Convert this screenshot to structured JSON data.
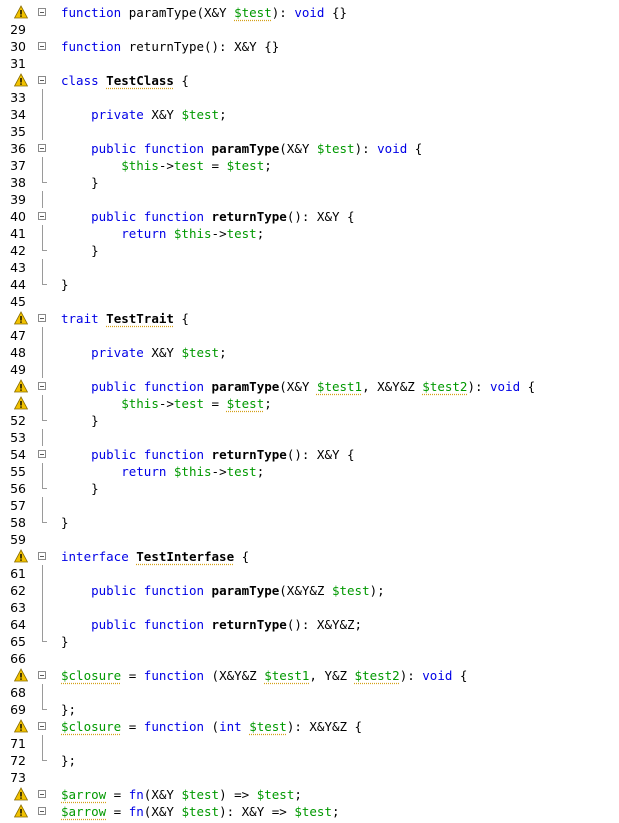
{
  "colors": {
    "keyword": "#0000e6",
    "variable": "#009900",
    "warning": "#e6b800",
    "text": "#000000"
  },
  "lines": [
    {
      "no": "",
      "warn": true,
      "fold": "start",
      "tokens": [
        {
          "t": "function",
          "c": "k"
        },
        {
          "t": " paramType(X&Y "
        },
        {
          "t": "$test",
          "c": "v wv"
        },
        {
          "t": "): "
        },
        {
          "t": "void",
          "c": "k"
        },
        {
          "t": " {}"
        }
      ]
    },
    {
      "no": "29",
      "tokens": []
    },
    {
      "no": "30",
      "fold": "start",
      "tokens": [
        {
          "t": "function",
          "c": "k"
        },
        {
          "t": " returnType(): X&Y {}"
        }
      ]
    },
    {
      "no": "31",
      "tokens": []
    },
    {
      "no": "",
      "warn": true,
      "fold": "start",
      "tokens": [
        {
          "t": "class",
          "c": "k"
        },
        {
          "t": " "
        },
        {
          "t": "TestClass",
          "c": "b wv"
        },
        {
          "t": " {"
        }
      ]
    },
    {
      "no": "33",
      "fold": "line",
      "tokens": []
    },
    {
      "no": "34",
      "fold": "line",
      "tokens": [
        {
          "t": "    "
        },
        {
          "t": "private",
          "c": "k"
        },
        {
          "t": " X&Y "
        },
        {
          "t": "$test",
          "c": "v"
        },
        {
          "t": ";"
        }
      ]
    },
    {
      "no": "35",
      "fold": "line",
      "tokens": []
    },
    {
      "no": "36",
      "fold": "start",
      "tokens": [
        {
          "t": "    "
        },
        {
          "t": "public",
          "c": "k"
        },
        {
          "t": " "
        },
        {
          "t": "function",
          "c": "k"
        },
        {
          "t": " "
        },
        {
          "t": "paramType",
          "c": "b"
        },
        {
          "t": "(X&Y "
        },
        {
          "t": "$test",
          "c": "v"
        },
        {
          "t": "): "
        },
        {
          "t": "void",
          "c": "k"
        },
        {
          "t": " {"
        }
      ]
    },
    {
      "no": "37",
      "fold": "line",
      "tokens": [
        {
          "t": "        "
        },
        {
          "t": "$this",
          "c": "v"
        },
        {
          "t": "->"
        },
        {
          "t": "test",
          "c": "v"
        },
        {
          "t": " = "
        },
        {
          "t": "$test",
          "c": "v"
        },
        {
          "t": ";"
        }
      ]
    },
    {
      "no": "38",
      "fold": "end",
      "tokens": [
        {
          "t": "    }"
        }
      ]
    },
    {
      "no": "39",
      "fold": "line",
      "tokens": []
    },
    {
      "no": "40",
      "fold": "start",
      "tokens": [
        {
          "t": "    "
        },
        {
          "t": "public",
          "c": "k"
        },
        {
          "t": " "
        },
        {
          "t": "function",
          "c": "k"
        },
        {
          "t": " "
        },
        {
          "t": "returnType",
          "c": "b"
        },
        {
          "t": "(): X&Y {"
        }
      ]
    },
    {
      "no": "41",
      "fold": "line",
      "tokens": [
        {
          "t": "        "
        },
        {
          "t": "return",
          "c": "k"
        },
        {
          "t": " "
        },
        {
          "t": "$this",
          "c": "v"
        },
        {
          "t": "->"
        },
        {
          "t": "test",
          "c": "v"
        },
        {
          "t": ";"
        }
      ]
    },
    {
      "no": "42",
      "fold": "end",
      "tokens": [
        {
          "t": "    }"
        }
      ]
    },
    {
      "no": "43",
      "fold": "line",
      "tokens": []
    },
    {
      "no": "44",
      "fold": "end",
      "tokens": [
        {
          "t": "}"
        }
      ]
    },
    {
      "no": "45",
      "tokens": []
    },
    {
      "no": "",
      "warn": true,
      "fold": "start",
      "tokens": [
        {
          "t": "trait",
          "c": "k"
        },
        {
          "t": " "
        },
        {
          "t": "TestTrait",
          "c": "b wv"
        },
        {
          "t": " {"
        }
      ]
    },
    {
      "no": "47",
      "fold": "line",
      "tokens": []
    },
    {
      "no": "48",
      "fold": "line",
      "tokens": [
        {
          "t": "    "
        },
        {
          "t": "private",
          "c": "k"
        },
        {
          "t": " X&Y "
        },
        {
          "t": "$test",
          "c": "v"
        },
        {
          "t": ";"
        }
      ]
    },
    {
      "no": "49",
      "fold": "line",
      "tokens": []
    },
    {
      "no": "",
      "warn": true,
      "fold": "start",
      "tokens": [
        {
          "t": "    "
        },
        {
          "t": "public",
          "c": "k"
        },
        {
          "t": " "
        },
        {
          "t": "function",
          "c": "k"
        },
        {
          "t": " "
        },
        {
          "t": "paramType",
          "c": "b"
        },
        {
          "t": "(X&Y "
        },
        {
          "t": "$test1",
          "c": "v wv"
        },
        {
          "t": ", X&Y&Z "
        },
        {
          "t": "$test2",
          "c": "v wv"
        },
        {
          "t": "): "
        },
        {
          "t": "void",
          "c": "k"
        },
        {
          "t": " {"
        }
      ]
    },
    {
      "no": "",
      "warn": true,
      "fold": "line",
      "tokens": [
        {
          "t": "        "
        },
        {
          "t": "$this",
          "c": "v"
        },
        {
          "t": "->"
        },
        {
          "t": "test",
          "c": "v"
        },
        {
          "t": " = "
        },
        {
          "t": "$test",
          "c": "v wv"
        },
        {
          "t": ";"
        }
      ]
    },
    {
      "no": "52",
      "fold": "end",
      "tokens": [
        {
          "t": "    }"
        }
      ]
    },
    {
      "no": "53",
      "fold": "line",
      "tokens": []
    },
    {
      "no": "54",
      "fold": "start",
      "tokens": [
        {
          "t": "    "
        },
        {
          "t": "public",
          "c": "k"
        },
        {
          "t": " "
        },
        {
          "t": "function",
          "c": "k"
        },
        {
          "t": " "
        },
        {
          "t": "returnType",
          "c": "b"
        },
        {
          "t": "(): X&Y {"
        }
      ]
    },
    {
      "no": "55",
      "fold": "line",
      "tokens": [
        {
          "t": "        "
        },
        {
          "t": "return",
          "c": "k"
        },
        {
          "t": " "
        },
        {
          "t": "$this",
          "c": "v"
        },
        {
          "t": "->"
        },
        {
          "t": "test",
          "c": "v"
        },
        {
          "t": ";"
        }
      ]
    },
    {
      "no": "56",
      "fold": "end",
      "tokens": [
        {
          "t": "    }"
        }
      ]
    },
    {
      "no": "57",
      "fold": "line",
      "tokens": []
    },
    {
      "no": "58",
      "fold": "end",
      "tokens": [
        {
          "t": "}"
        }
      ]
    },
    {
      "no": "59",
      "tokens": []
    },
    {
      "no": "",
      "warn": true,
      "fold": "start",
      "tokens": [
        {
          "t": "interface",
          "c": "k"
        },
        {
          "t": " "
        },
        {
          "t": "TestInterfase",
          "c": "b wv"
        },
        {
          "t": " {"
        }
      ]
    },
    {
      "no": "61",
      "fold": "line",
      "tokens": []
    },
    {
      "no": "62",
      "fold": "line",
      "tokens": [
        {
          "t": "    "
        },
        {
          "t": "public",
          "c": "k"
        },
        {
          "t": " "
        },
        {
          "t": "function",
          "c": "k"
        },
        {
          "t": " "
        },
        {
          "t": "paramType",
          "c": "b"
        },
        {
          "t": "(X&Y&Z "
        },
        {
          "t": "$test",
          "c": "v"
        },
        {
          "t": ");"
        }
      ]
    },
    {
      "no": "63",
      "fold": "line",
      "tokens": []
    },
    {
      "no": "64",
      "fold": "line",
      "tokens": [
        {
          "t": "    "
        },
        {
          "t": "public",
          "c": "k"
        },
        {
          "t": " "
        },
        {
          "t": "function",
          "c": "k"
        },
        {
          "t": " "
        },
        {
          "t": "returnType",
          "c": "b"
        },
        {
          "t": "(): X&Y&Z;"
        }
      ]
    },
    {
      "no": "65",
      "fold": "end",
      "tokens": [
        {
          "t": "}"
        }
      ]
    },
    {
      "no": "66",
      "tokens": []
    },
    {
      "no": "",
      "warn": true,
      "fold": "start",
      "tokens": [
        {
          "t": "$closure",
          "c": "v wv"
        },
        {
          "t": " = "
        },
        {
          "t": "function",
          "c": "k"
        },
        {
          "t": " (X&Y&Z "
        },
        {
          "t": "$test1",
          "c": "v wv"
        },
        {
          "t": ", Y&Z "
        },
        {
          "t": "$test2",
          "c": "v wv"
        },
        {
          "t": "): "
        },
        {
          "t": "void",
          "c": "k"
        },
        {
          "t": " {"
        }
      ]
    },
    {
      "no": "68",
      "fold": "line",
      "tokens": []
    },
    {
      "no": "69",
      "fold": "end",
      "tokens": [
        {
          "t": "};"
        }
      ]
    },
    {
      "no": "",
      "warn": true,
      "fold": "start",
      "tokens": [
        {
          "t": "$closure",
          "c": "v wv"
        },
        {
          "t": " = "
        },
        {
          "t": "function",
          "c": "k"
        },
        {
          "t": " ("
        },
        {
          "t": "int",
          "c": "k"
        },
        {
          "t": " "
        },
        {
          "t": "$test",
          "c": "v wv"
        },
        {
          "t": "): X&Y&Z {"
        }
      ]
    },
    {
      "no": "71",
      "fold": "line",
      "tokens": []
    },
    {
      "no": "72",
      "fold": "end",
      "tokens": [
        {
          "t": "};"
        }
      ]
    },
    {
      "no": "73",
      "tokens": []
    },
    {
      "no": "",
      "warn": true,
      "fold": "start",
      "tokens": [
        {
          "t": "$arrow",
          "c": "v wv"
        },
        {
          "t": " = "
        },
        {
          "t": "fn",
          "c": "k"
        },
        {
          "t": "(X&Y "
        },
        {
          "t": "$test",
          "c": "v"
        },
        {
          "t": ") => "
        },
        {
          "t": "$test",
          "c": "v"
        },
        {
          "t": ";"
        }
      ]
    },
    {
      "no": "",
      "warn": true,
      "fold": "start",
      "tokens": [
        {
          "t": "$arrow",
          "c": "v wv"
        },
        {
          "t": " = "
        },
        {
          "t": "fn",
          "c": "k"
        },
        {
          "t": "(X&Y "
        },
        {
          "t": "$test",
          "c": "v"
        },
        {
          "t": "): X&Y => "
        },
        {
          "t": "$test",
          "c": "v"
        },
        {
          "t": ";"
        }
      ]
    }
  ]
}
